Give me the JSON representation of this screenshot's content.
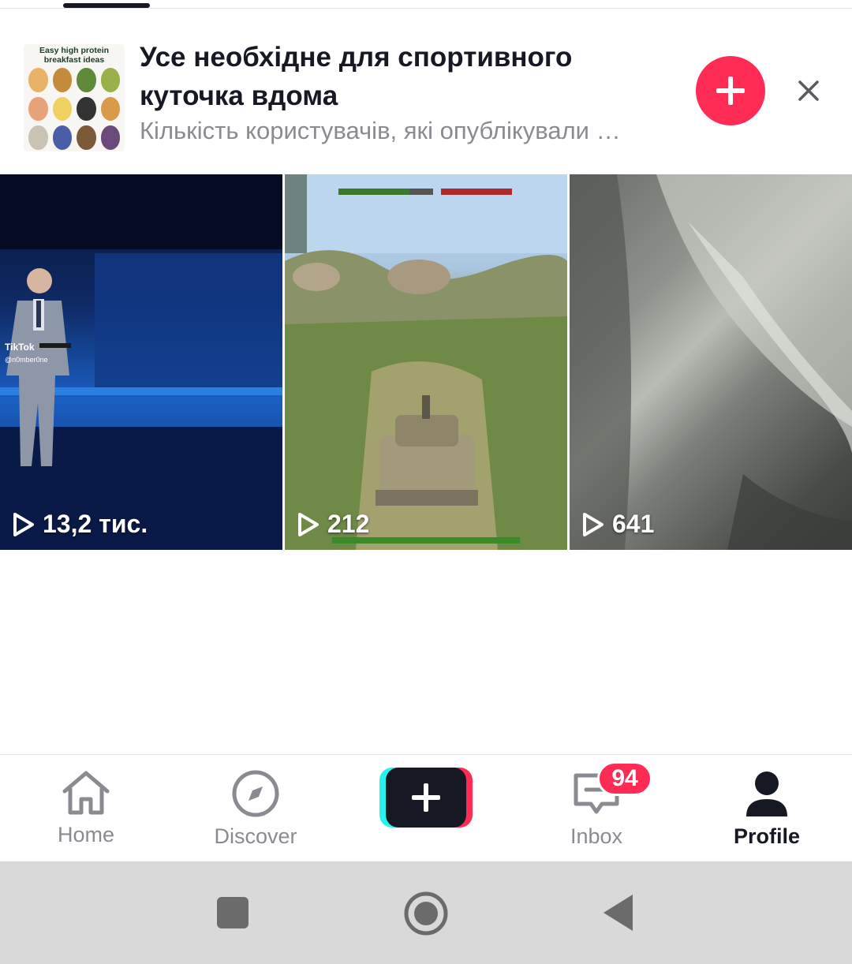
{
  "banner": {
    "thumb_title": "Easy high protein breakfast ideas",
    "title": "Усе необхідне для спортивного куточка вдома",
    "subtitle": "Кількість користувачів, які опублікували …"
  },
  "videos": [
    {
      "views": "13,2 тис.",
      "overlay_brand": "TikTok",
      "overlay_user": "@n0mber0ne"
    },
    {
      "views": "212"
    },
    {
      "views": "641"
    }
  ],
  "nav": {
    "home": "Home",
    "discover": "Discover",
    "inbox": "Inbox",
    "inbox_badge": "94",
    "profile": "Profile"
  },
  "colors": {
    "accent": "#fe2c55",
    "text": "#161823",
    "muted": "#8a8b91"
  },
  "icons": {
    "home": "home-icon",
    "discover": "compass-icon",
    "create": "plus-icon",
    "inbox": "inbox-icon",
    "profile": "profile-icon",
    "views": "play-icon",
    "close": "close-icon"
  }
}
